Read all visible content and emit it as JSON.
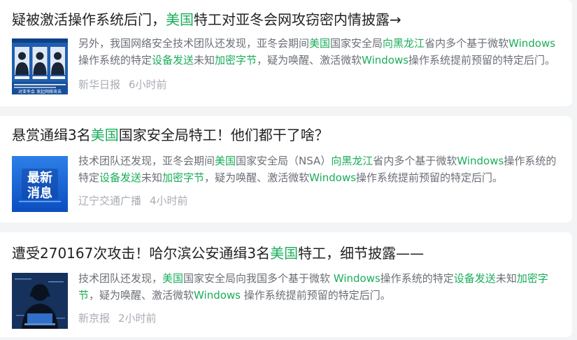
{
  "colors": {
    "highlight": "#1aad5a",
    "title_text": "#222222",
    "snippet_text": "#6b6f76",
    "meta_text": "#a8acb3",
    "page_background": "#f3f4f6",
    "card_background": "#ffffff"
  },
  "articles": [
    {
      "title_parts": [
        {
          "text": "疑被激活操作系统后门，",
          "hl": false
        },
        {
          "text": "美国",
          "hl": true
        },
        {
          "text": "特工对亚冬会网攻窃密内情披露→",
          "hl": false
        }
      ],
      "snippet_parts": [
        {
          "text": "另外，我国网络安全技术团队还发现，亚冬会期间",
          "hl": false
        },
        {
          "text": "美国",
          "hl": true
        },
        {
          "text": "国家安全局",
          "hl": false
        },
        {
          "text": "向黑龙江",
          "hl": true
        },
        {
          "text": "省内多个基于微软",
          "hl": false
        },
        {
          "text": "Windows",
          "hl": true
        },
        {
          "text": "操作系统的特定",
          "hl": false
        },
        {
          "text": "设备发送",
          "hl": true
        },
        {
          "text": "未知",
          "hl": false
        },
        {
          "text": "加密字节",
          "hl": true
        },
        {
          "text": "，疑为唤醒、激活微软",
          "hl": false
        },
        {
          "text": "Windows",
          "hl": true
        },
        {
          "text": "操作系统提前预留的特定后门。",
          "hl": false
        }
      ],
      "source": "新华日报",
      "time": "6小时前",
      "thumbnail": {
        "icon": "agents-wanted-poster-icon",
        "caption": "对亚冬会 发起网络攻击"
      }
    },
    {
      "title_parts": [
        {
          "text": "悬赏通缉3名",
          "hl": false
        },
        {
          "text": "美国",
          "hl": true
        },
        {
          "text": "国家安全局特工！他们都干了啥？",
          "hl": false
        }
      ],
      "snippet_parts": [
        {
          "text": "技术团队还发现，亚冬会期间",
          "hl": false
        },
        {
          "text": "美国",
          "hl": true
        },
        {
          "text": "国家安全局（NSA）",
          "hl": false
        },
        {
          "text": "向黑龙江",
          "hl": true
        },
        {
          "text": "省内多个基于微软",
          "hl": false
        },
        {
          "text": "Windows",
          "hl": true
        },
        {
          "text": "操作系统的特定",
          "hl": false
        },
        {
          "text": "设备发送",
          "hl": true
        },
        {
          "text": "未知",
          "hl": false
        },
        {
          "text": "加密字节",
          "hl": true
        },
        {
          "text": "，疑为唤醒、激活微软",
          "hl": false
        },
        {
          "text": "Windows",
          "hl": true
        },
        {
          "text": "操作系统提前预留的特定后门。",
          "hl": false
        }
      ],
      "source": "辽宁交通广播",
      "time": "4小时前",
      "thumbnail": {
        "icon": "breaking-news-badge-icon",
        "badge_line1": "最新",
        "badge_line2": "消息"
      }
    },
    {
      "title_parts": [
        {
          "text": "遭受270167次攻击！哈尔滨公安通缉3名",
          "hl": false
        },
        {
          "text": "美国",
          "hl": true
        },
        {
          "text": "特工，细节披露——",
          "hl": false
        }
      ],
      "snippet_parts": [
        {
          "text": "技术团队还发现，",
          "hl": false
        },
        {
          "text": "美国",
          "hl": true
        },
        {
          "text": "国家安全局向我国多个基于微软 ",
          "hl": false
        },
        {
          "text": "Windows",
          "hl": true
        },
        {
          "text": "操作系统的特定",
          "hl": false
        },
        {
          "text": "设备发送",
          "hl": true
        },
        {
          "text": "未知",
          "hl": false
        },
        {
          "text": "加密字节",
          "hl": true
        },
        {
          "text": "，疑为唤醒、激活微软",
          "hl": false
        },
        {
          "text": "Windows",
          "hl": true
        },
        {
          "text": " 操作系统提前预留的特定后门。",
          "hl": false
        }
      ],
      "source": "新京报",
      "time": "2小时前",
      "thumbnail": {
        "icon": "hacker-silhouette-icon"
      }
    }
  ]
}
